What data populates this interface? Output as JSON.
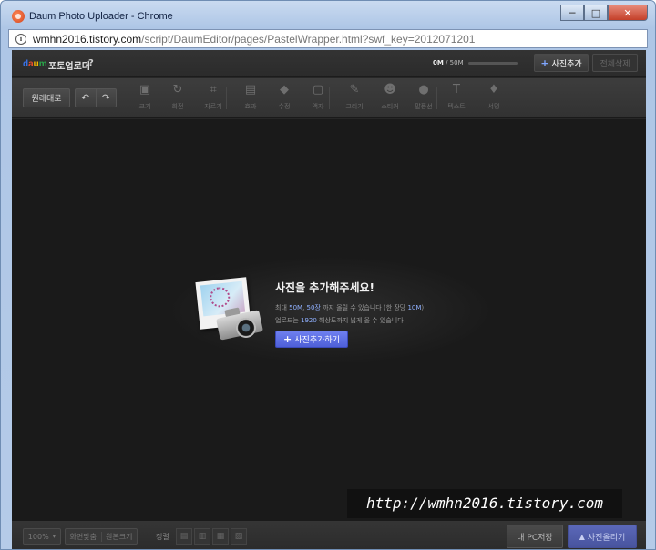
{
  "window": {
    "title": "Daum Photo Uploader - Chrome",
    "controls": {
      "minimize": "─",
      "maximize": "□",
      "close": "✕"
    }
  },
  "address_bar": {
    "host": "wmhn2016.tistory.com",
    "path": "/script/DaumEditor/pages/PastelWrapper.html?swf_key=2012071201"
  },
  "header": {
    "logo": {
      "d": "d",
      "a": "a",
      "u": "u",
      "m": "m"
    },
    "title": "포토업로더",
    "help": "?",
    "size_used": "0M",
    "size_total": "/ 50M",
    "size_fraction": 0,
    "add_photo": "사진추가",
    "delete_all": "전체삭제"
  },
  "toolbar": {
    "original": "원래대로",
    "undo_icon": "↶",
    "redo_icon": "↷",
    "tools": [
      {
        "label": "크기",
        "icon": "▣"
      },
      {
        "label": "회전",
        "icon": "↻"
      },
      {
        "label": "자르기",
        "icon": "⌗"
      },
      {
        "label": "효과",
        "icon": "▤"
      },
      {
        "label": "수정",
        "icon": "◆"
      },
      {
        "label": "액자",
        "icon": "▢"
      },
      {
        "label": "그리기",
        "icon": "✎"
      },
      {
        "label": "스티커",
        "icon": "☻"
      },
      {
        "label": "말풍선",
        "icon": "●"
      },
      {
        "label": "텍스트",
        "icon": "T"
      },
      {
        "label": "서명",
        "icon": "♦"
      }
    ]
  },
  "empty_state": {
    "title": "사진을 추가해주세요!",
    "line1": {
      "p1": "최대 ",
      "max_size": "50M",
      "p2": ", ",
      "max_count": "50장",
      "p3": " 까지 올릴 수 있습니다  (한 장당 ",
      "per_file": "10M",
      "p4": ")"
    },
    "line2": {
      "p1": "업로드는 ",
      "resolution": "1920",
      "p2": " 해상도까지 넓게 올 수 있습니다"
    },
    "button": "사진추가하기"
  },
  "watermark": "http://wmhn2016.tistory.com",
  "bottom": {
    "zoom": "100%",
    "zoom_caret": "▾",
    "fit_screen": "화면맞춤",
    "original_size": "원본크기",
    "sort_label": "정렬",
    "sort_icons": [
      "▤",
      "▥",
      "▦",
      "▧"
    ],
    "save_pc": "내 PC저장",
    "upload": "사진올리기",
    "upload_icon": "▲"
  },
  "colors": {
    "accent": "#5b6ae0",
    "highlight_text": "#8fb0ff",
    "canvas_bg": "#1a1a1a"
  }
}
